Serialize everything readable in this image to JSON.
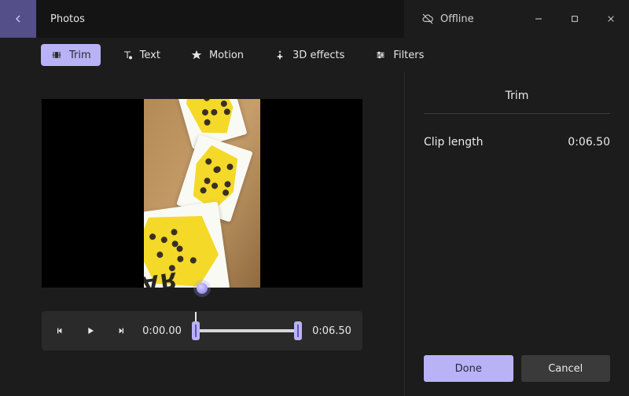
{
  "app_title": "Photos",
  "offline_label": "Offline",
  "window": {
    "minimize": "—",
    "maximize": "▢",
    "close": "✕"
  },
  "toolbar": {
    "trim": "Trim",
    "text": "Text",
    "motion": "Motion",
    "fx3d": "3D effects",
    "filters": "Filters"
  },
  "playback": {
    "start_time": "0:00.00",
    "end_time": "0:06.50"
  },
  "side": {
    "title": "Trim",
    "clip_label": "Clip length",
    "clip_value": "0:06.50",
    "done": "Done",
    "cancel": "Cancel"
  },
  "colors": {
    "accent": "#b9b2f6",
    "accent_dark": "#544f88",
    "bg": "#1c1c1c",
    "surface": "#2a2a2a"
  }
}
